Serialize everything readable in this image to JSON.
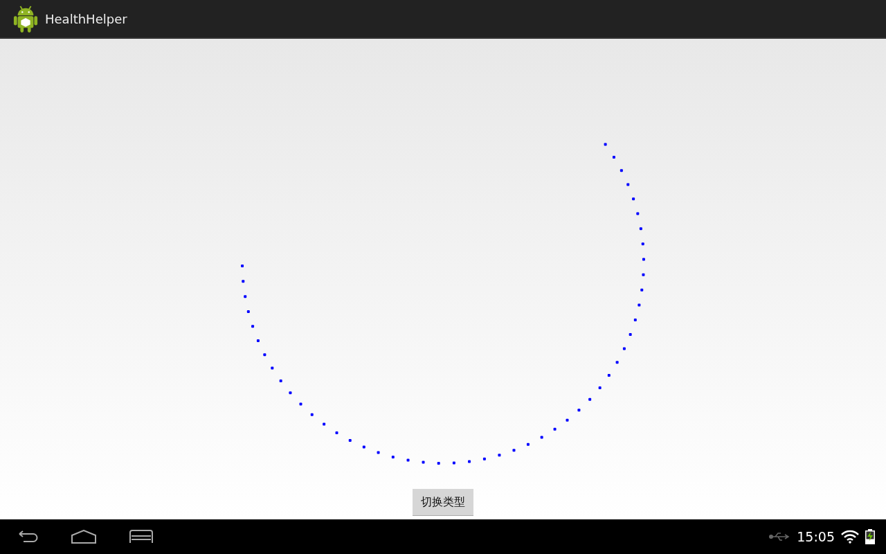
{
  "action_bar": {
    "title": "HealthHelper"
  },
  "content": {
    "switch_button": {
      "label": "切换类型"
    }
  },
  "status_bar": {
    "time": "15:05"
  }
}
